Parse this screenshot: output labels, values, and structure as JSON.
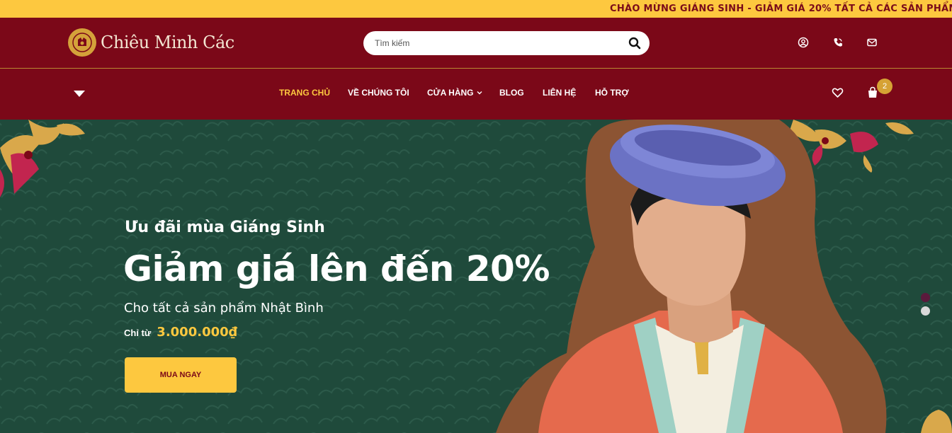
{
  "announcement": {
    "text": "CHÀO MỪNG GIÁNG SINH - GIẢM GIÁ 20% TẤT CẢ CÁC SẢN PHẨM"
  },
  "header": {
    "logo_text": "Chiêu Minh Các",
    "search": {
      "placeholder": "Tìm kiếm",
      "value": ""
    },
    "icons": [
      "user-icon",
      "phone-icon",
      "mail-icon"
    ],
    "cart_count": "2"
  },
  "nav": {
    "items": [
      {
        "label": "TRANG CHỦ",
        "active": true
      },
      {
        "label": "VỀ CHÚNG TÔI",
        "active": false
      },
      {
        "label": "CỬA HÀNG",
        "active": false,
        "has_dropdown": true
      },
      {
        "label": "BLOG",
        "active": false
      },
      {
        "label": "LIÊN HỆ",
        "active": false
      },
      {
        "label": "HỖ TRỢ",
        "active": false
      }
    ]
  },
  "hero": {
    "subtitle": "Ưu đãi mùa Giáng Sinh",
    "title": "Giảm giá lên đến 20%",
    "description": "Cho tất cả sản phẩm Nhật Bình",
    "price_label": "Chỉ từ",
    "price_value": "3.000.000₫",
    "cta_label": "MUA NGAY",
    "active_slide": 1,
    "slide_count": 2
  },
  "colors": {
    "announcement_bg": "#fdc83f",
    "header_bg": "#7b0818",
    "accent_gold": "#fdc83f",
    "hero_bg": "#1f4a3b"
  }
}
